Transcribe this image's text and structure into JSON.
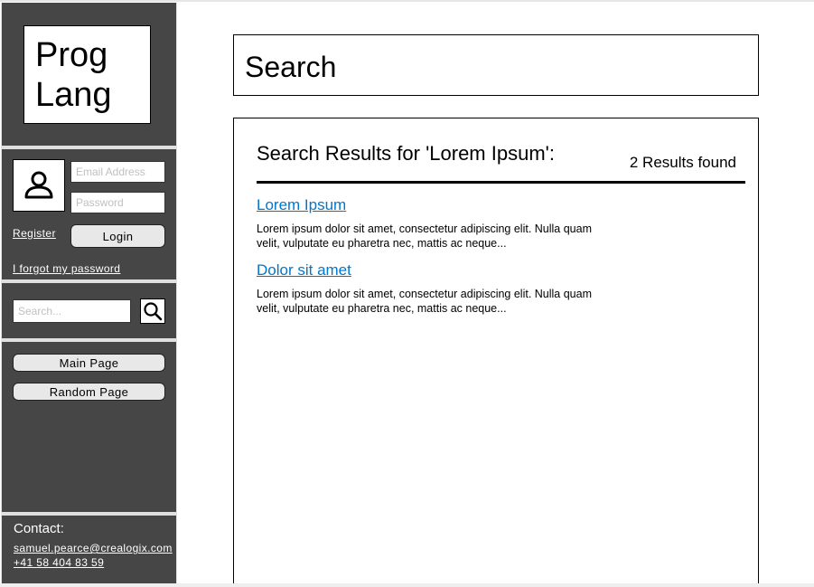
{
  "sidebar": {
    "logo_line1": "Prog",
    "logo_line2": "Lang",
    "login": {
      "email_placeholder": "Email Address",
      "password_placeholder": "Password",
      "register_label": "Register",
      "login_label": "Login",
      "forgot_label": "I forgot my password"
    },
    "search": {
      "placeholder": "Search...",
      "icon": "search-icon"
    },
    "nav": {
      "main_page_label": "Main Page",
      "random_page_label": "Random Page"
    },
    "contact": {
      "title": "Contact:",
      "email": "samuel.pearce@crealogix.com",
      "phone": "+41 58 404 83 59"
    }
  },
  "main": {
    "page_title": "Search",
    "results": {
      "heading": "Search Results for 'Lorem Ipsum':",
      "count": "2 Results found",
      "items": [
        {
          "title": "Lorem Ipsum",
          "snippet": "Lorem ipsum dolor sit amet, consectetur adipiscing elit. Nulla quam velit, vulputate eu pharetra nec, mattis ac neque..."
        },
        {
          "title": "Dolor sit amet",
          "snippet": "Lorem ipsum dolor sit amet, consectetur adipiscing elit. Nulla quam velit, vulputate eu pharetra nec, mattis ac neque..."
        }
      ]
    }
  },
  "colors": {
    "sidebar_bg": "#464646",
    "link_blue": "#0077cc",
    "button_bg": "#e8e8e8"
  }
}
